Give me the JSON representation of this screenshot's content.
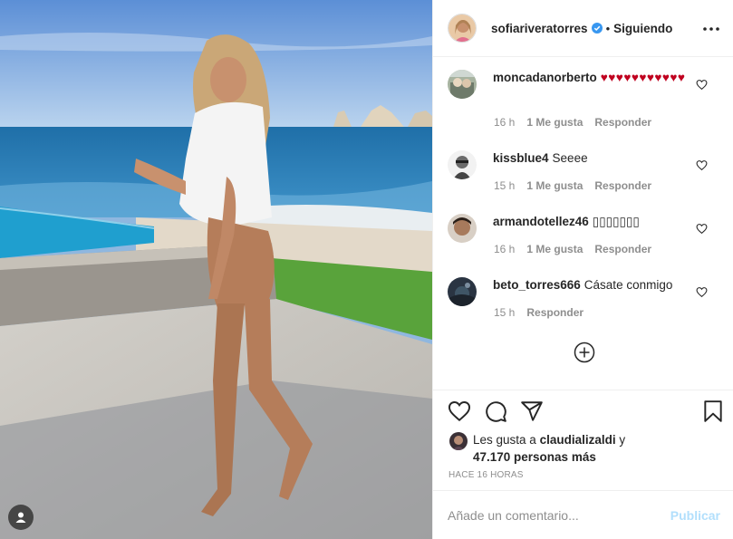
{
  "post": {
    "username": "sofiariveratorres",
    "verified": true,
    "separator": "•",
    "follow_status": "Siguiendo",
    "menu_icon": "more-horizontal-icon"
  },
  "comments": [
    {
      "username": "moncadanorberto",
      "text": "♥♥♥♥♥♥♥♥♥♥♥",
      "time": "16 h",
      "likes": "1 Me gusta",
      "reply": "Responder"
    },
    {
      "username": "kissblue4",
      "text": "Seeee",
      "time": "15 h",
      "likes": "1 Me gusta",
      "reply": "Responder"
    },
    {
      "username": "armandotellez46",
      "text": "▯▯▯▯▯▯▯",
      "time": "16 h",
      "likes": "1 Me gusta",
      "reply": "Responder"
    },
    {
      "username": "beto_torres666",
      "text": "Cásate conmigo",
      "time": "15 h",
      "reply": "Responder"
    }
  ],
  "likes": {
    "prefix": "Les gusta a",
    "user": "claudializaldi",
    "connector": "y",
    "count": "47.170 personas más"
  },
  "posted_ago": "HACE 16 HORAS",
  "comment_box": {
    "placeholder": "Añade un comentario...",
    "publish_label": "Publicar"
  },
  "colors": {
    "text": "#262626",
    "muted": "#8e8e8e",
    "verified": "#3897f0",
    "hearts": "#c0001f",
    "publish_disabled": "#b2dffc",
    "border": "#efefef"
  }
}
